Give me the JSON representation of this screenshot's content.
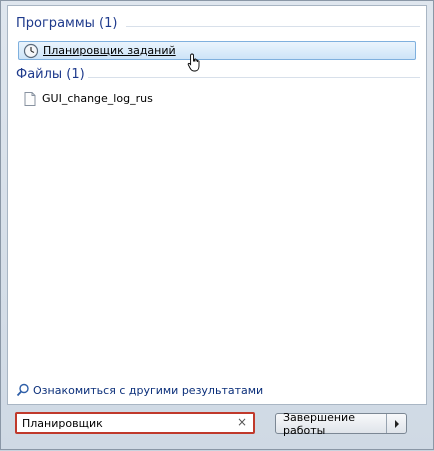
{
  "programs": {
    "header": "Программы (1)",
    "items": [
      {
        "label": "Планировщик заданий",
        "icon": "task-scheduler-clock-icon"
      }
    ]
  },
  "files": {
    "header": "Файлы (1)",
    "items": [
      {
        "label": "GUI_change_log_rus",
        "icon": "text-file-icon"
      }
    ]
  },
  "more_results": "Ознакомиться с другими результатами",
  "search": {
    "value": "Планировщик",
    "clear_glyph": "×"
  },
  "shutdown": {
    "label": "Завершение работы"
  },
  "colors": {
    "header_text": "#1e3a8c",
    "search_highlight": "#c0392b",
    "selection_border": "#7fb0de"
  }
}
